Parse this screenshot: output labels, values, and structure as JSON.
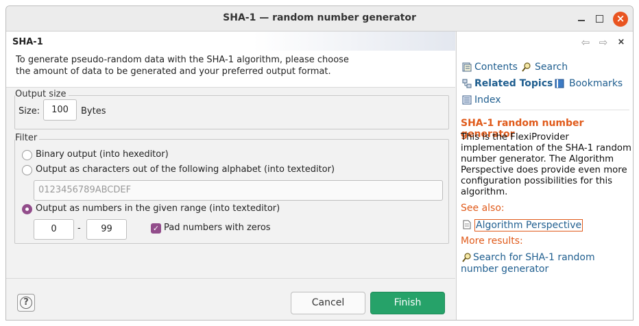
{
  "window": {
    "title": "SHA-1 — random number generator",
    "close_glyph": "×"
  },
  "dialog": {
    "title": "SHA-1",
    "description_line1": "To generate pseudo-random data with the SHA-1 algorithm, please choose",
    "description_line2": "the amount of data to be generated and your preferred output format."
  },
  "output_size": {
    "legend": "Output size",
    "size_label": "Size:",
    "size_value": "100",
    "unit": "Bytes"
  },
  "filter": {
    "legend": "Filter",
    "option_binary": "Binary output (into hexeditor)",
    "option_chars": "Output as characters out of the following alphabet (into texteditor)",
    "alphabet_placeholder": "0123456789ABCDEF",
    "option_numbers": "Output as numbers in the given range (into texteditor)",
    "selected": "numbers",
    "range_from": "0",
    "range_dash": "-",
    "range_to": "99",
    "pad_label": "Pad numbers with zeros",
    "pad_checked": true
  },
  "buttons": {
    "help_glyph": "?",
    "cancel": "Cancel",
    "finish": "Finish"
  },
  "help_panel": {
    "nav_back": "⇦",
    "nav_forward": "⇨",
    "close": "×",
    "contents": "Contents",
    "search": "Search",
    "related_topics": "Related Topics",
    "bookmarks": "Bookmarks",
    "index": "Index",
    "heading": "SHA-1 random number generator",
    "body": "This is the FlexiProvider implementation of the SHA-1 random number generator. The Algorithm Perspective does provide even more configuration possibilities for this algorithm.",
    "see_also": "See also:",
    "see_also_link": "Algorithm Perspective",
    "more_results": "More results:",
    "search_link": "Search for SHA-1 random number generator"
  },
  "colors": {
    "accent": "#924d8b",
    "finish": "#26a269",
    "close": "#e95420",
    "help_heading": "#e05a1a",
    "link": "#1f5e8f"
  }
}
